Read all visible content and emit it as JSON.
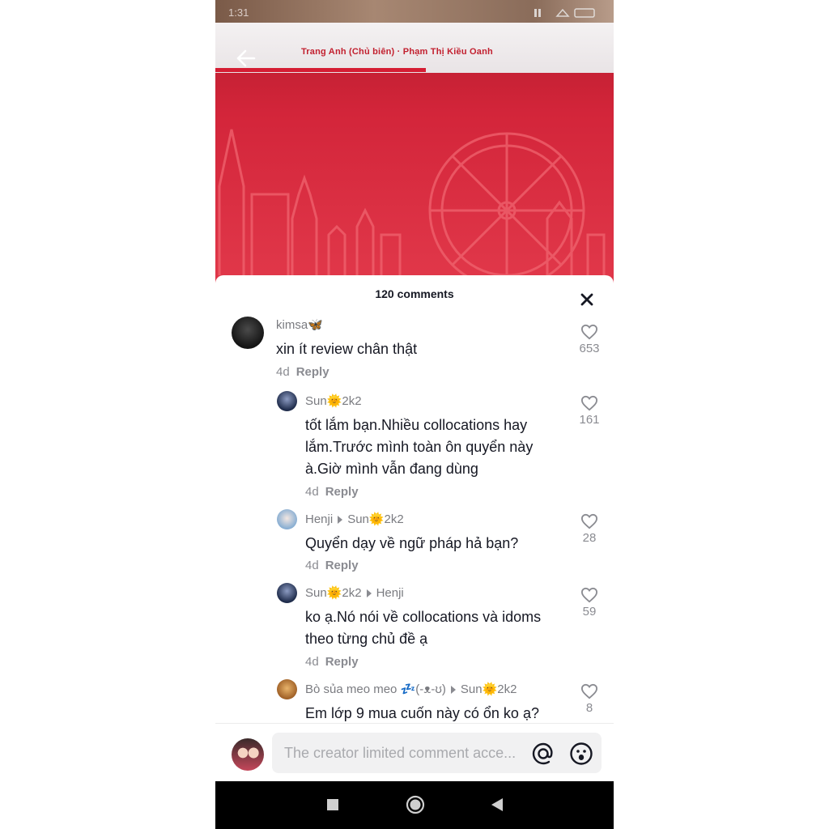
{
  "status_bar": {
    "time": "1:31"
  },
  "video": {
    "cover_text": "Trang Anh (Chủ biên) · Phạm Thị Kiều Oanh"
  },
  "sheet": {
    "title": "120 comments"
  },
  "comments": [
    {
      "user": "kimsa🦋",
      "text": "xin ít review chân thật",
      "age": "4d",
      "reply_label": "Reply",
      "likes": "653"
    },
    {
      "user": "Sun🌞2k2",
      "text": "tốt lắm bạn.Nhiều collocations hay lắm.Trước mình toàn ôn quyển này à.Giờ mình vẫn đang dùng",
      "age": "4d",
      "reply_label": "Reply",
      "likes": "161"
    },
    {
      "user": "Henji",
      "reply_to": "Sun🌞2k2",
      "text": "Quyển dạy về ngữ pháp hả bạn?",
      "age": "4d",
      "reply_label": "Reply",
      "likes": "28"
    },
    {
      "user": "Sun🌞2k2",
      "reply_to": "Henji",
      "text": "ko ạ.Nó nói về collocations và idoms theo từng chủ đề ạ",
      "age": "4d",
      "reply_label": "Reply",
      "likes": "59"
    },
    {
      "user": "Bò sủa meo meo 💤(-ᴥ-ʊ)",
      "reply_to": "Sun🌞2k2",
      "text": "Em lớp 9 mua cuốn này có ổn ko ạ?",
      "likes": "8"
    }
  ],
  "input": {
    "placeholder": "The creator limited comment acce..."
  },
  "colors": {
    "accent_red": "#d3253a",
    "text_primary": "#161823",
    "text_secondary": "#8a8b91"
  },
  "icons": [
    "back-arrow-icon",
    "close-icon",
    "heart-icon",
    "at-icon",
    "emoji-icon",
    "nav-square-icon",
    "nav-home-icon",
    "nav-back-icon"
  ]
}
